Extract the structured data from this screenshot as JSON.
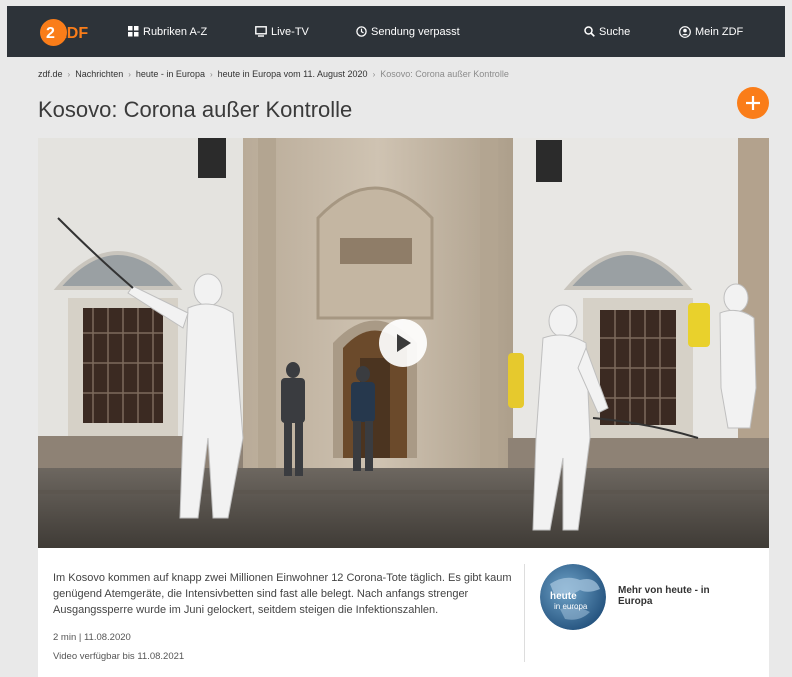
{
  "nav": {
    "logo_text": "ZDF",
    "rubriken_label": "Rubriken A-Z",
    "livetv_label": "Live-TV",
    "verpasst_label": "Sendung verpasst",
    "suche_label": "Suche",
    "meinzdf_label": "Mein ZDF",
    "brand_color": "#fa7d19"
  },
  "breadcrumb": {
    "items": [
      "zdf.de",
      "Nachrichten",
      "heute - in Europa",
      "heute in Europa vom 11. August 2020"
    ],
    "current": "Kosovo: Corona außer Kontrolle"
  },
  "page": {
    "title": "Kosovo: Corona außer Kontrolle"
  },
  "video": {
    "description": "Im Kosovo kommen auf knapp zwei Millionen Einwohner 12 Corona-Tote täglich. Es gibt kaum genügend Atemgeräte, die Intensivbetten sind fast alle belegt. Nach anfangs strenger Ausgangssperre wurde im Juni gelockert, seitdem steigen die Infektionszahlen.",
    "meta": "2 min | 11.08.2020",
    "availability": "Video verfügbar bis 11.08.2021"
  },
  "more": {
    "label": "Mehr von heute - in Europa",
    "thumb_title": "heute",
    "thumb_subtitle": "in europa"
  }
}
